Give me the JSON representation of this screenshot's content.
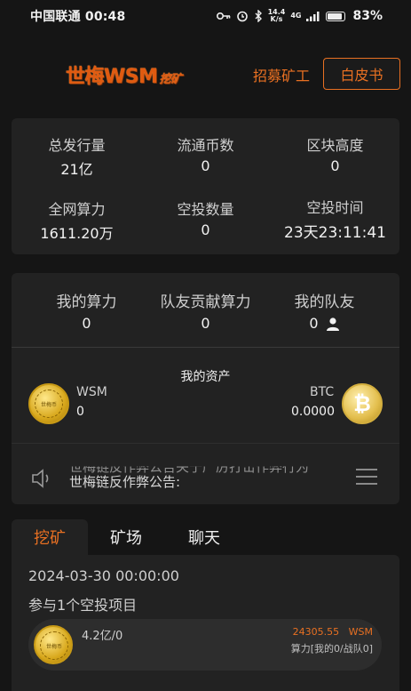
{
  "status_bar": {
    "carrier_time": "中国联通 00:48",
    "speed_top": "14.4",
    "speed_unit": "K/s",
    "network": "4G",
    "battery": "83%"
  },
  "header": {
    "logo_main": "世梅WSM",
    "logo_sub": "挖矿",
    "recruit_label": "招募矿工",
    "whitepaper_label": "白皮书"
  },
  "stats": {
    "total_issued_label": "总发行量",
    "total_issued_value": "21亿",
    "circulating_label": "流通币数",
    "circulating_value": "0",
    "block_height_label": "区块高度",
    "block_height_value": "0",
    "network_hashrate_label": "全网算力",
    "network_hashrate_value": "1611.20万",
    "airdrop_count_label": "空投数量",
    "airdrop_count_value": "0",
    "airdrop_time_label": "空投时间",
    "airdrop_time_value": "23天23:11:41"
  },
  "team": {
    "my_power_label": "我的算力",
    "my_power_value": "0",
    "team_power_label": "队友贡献算力",
    "team_power_value": "0",
    "my_team_label": "我的队友",
    "my_team_value": "0"
  },
  "assets": {
    "title": "我的资产",
    "wsm_name": "WSM",
    "wsm_value": "0",
    "btc_name": "BTC",
    "btc_value": "0.0000",
    "coin_wsm_text": "世梅币"
  },
  "notice": {
    "text": "世梅链反作弊公告:",
    "ghost_text": "世梅链反作弊公告关于严厉打击作弊行为"
  },
  "tabs": [
    {
      "label": "挖矿",
      "active": true
    },
    {
      "label": "矿场",
      "active": false
    },
    {
      "label": "聊天",
      "active": false
    }
  ],
  "mining": {
    "date": "2024-03-30 00:00:00",
    "participate_text": "参与1个空投项目",
    "project": {
      "amount": "4.2亿/0",
      "reward_value": "24305.55",
      "reward_unit": "WSM",
      "power_text": "算力[我的0/战队0]"
    }
  },
  "colors": {
    "accent": "#e87022",
    "background": "#151515",
    "card": "#222222"
  }
}
